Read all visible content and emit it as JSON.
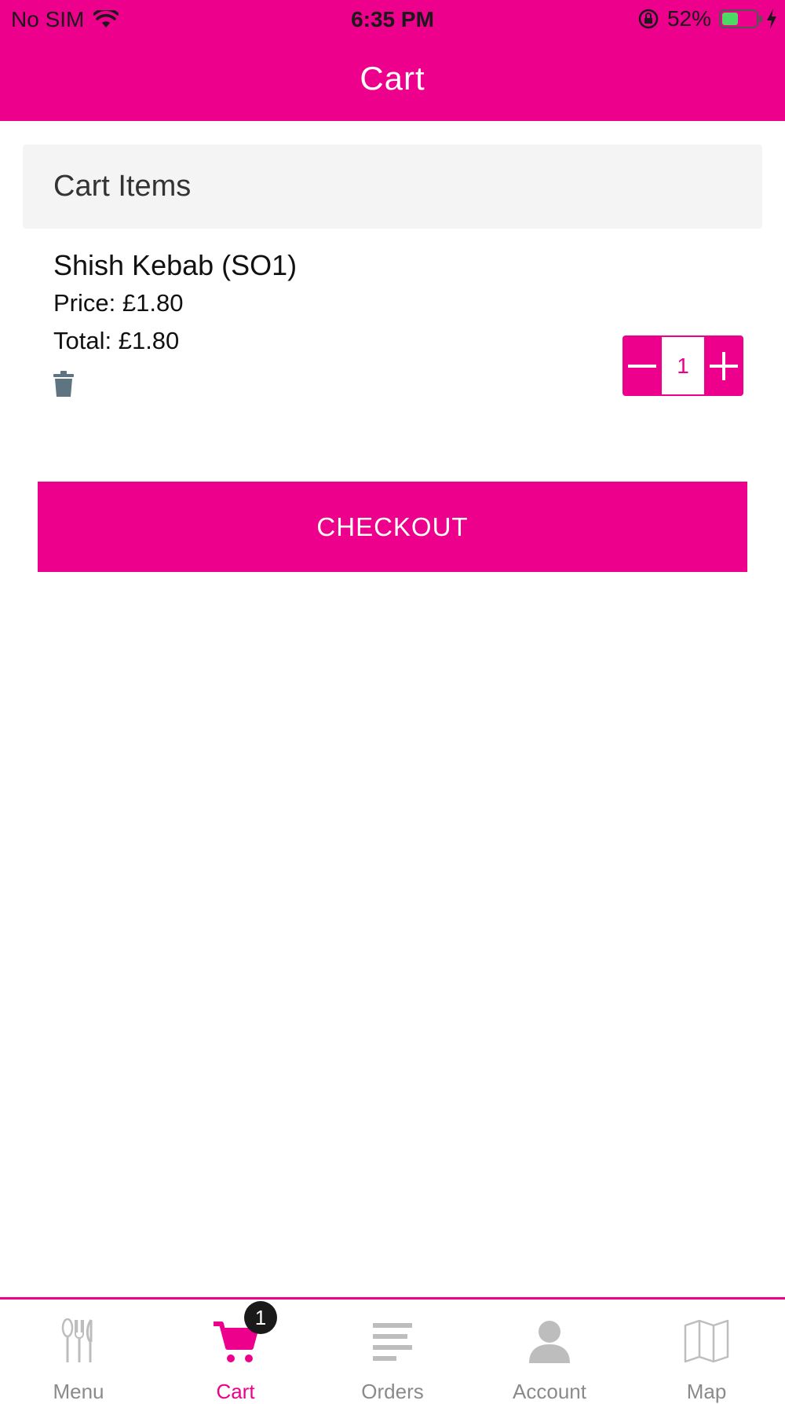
{
  "status_bar": {
    "carrier": "No SIM",
    "time": "6:35 PM",
    "battery": "52%",
    "battery_level": 0.52
  },
  "header": {
    "title": "Cart"
  },
  "cart": {
    "section_title": "Cart Items",
    "items": [
      {
        "name": "Shish Kebab (SO1)",
        "price": "Price: £1.80",
        "total": "Total: £1.80",
        "quantity": "1"
      }
    ]
  },
  "checkout_label": "CHECKOUT",
  "tabs": [
    {
      "label": "Menu",
      "icon": "fork-knife-icon"
    },
    {
      "label": "Cart",
      "icon": "cart-icon",
      "badge": "1"
    },
    {
      "label": "Orders",
      "icon": "lines-icon"
    },
    {
      "label": "Account",
      "icon": "person-icon"
    },
    {
      "label": "Map",
      "icon": "map-icon"
    }
  ],
  "colors": {
    "accent": "#ec008c",
    "inactive": "#bdbdbd",
    "trash": "#5f7481"
  }
}
